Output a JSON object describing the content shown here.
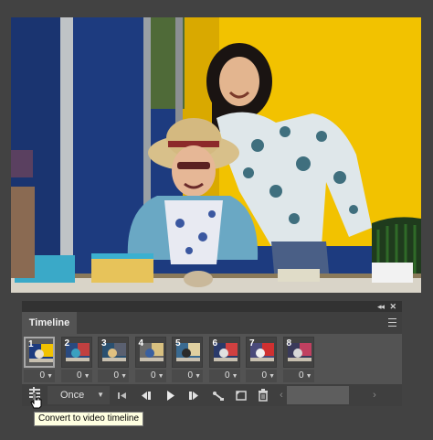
{
  "panel": {
    "tab_label": "Timeline"
  },
  "frames": [
    {
      "number": "1",
      "delay": "0",
      "selected": true
    },
    {
      "number": "2",
      "delay": "0",
      "selected": false
    },
    {
      "number": "3",
      "delay": "0",
      "selected": false
    },
    {
      "number": "4",
      "delay": "0",
      "selected": false
    },
    {
      "number": "5",
      "delay": "0",
      "selected": false
    },
    {
      "number": "6",
      "delay": "0",
      "selected": false
    },
    {
      "number": "7",
      "delay": "0",
      "selected": false
    },
    {
      "number": "8",
      "delay": "0",
      "selected": false
    }
  ],
  "controls": {
    "loop_value": "Once"
  },
  "tooltip": {
    "text": "Convert to video timeline"
  },
  "icons": {
    "convert": "convert-to-video-timeline-icon",
    "first": "select-first-frame-icon",
    "prev": "previous-frame-icon",
    "play": "play-icon",
    "next": "next-frame-icon",
    "tween": "tween-icon",
    "duplicate": "duplicate-frame-icon",
    "delete": "trash-icon",
    "scroll_left": "chevron-left-icon",
    "scroll_right": "chevron-right-icon",
    "collapse": "double-chevron-icon",
    "close": "close-icon",
    "panel_menu": "panel-menu-icon"
  },
  "colors": {
    "app_background": "#424242",
    "panel_background": "#535353",
    "tooltip_background": "#ffffe1"
  }
}
